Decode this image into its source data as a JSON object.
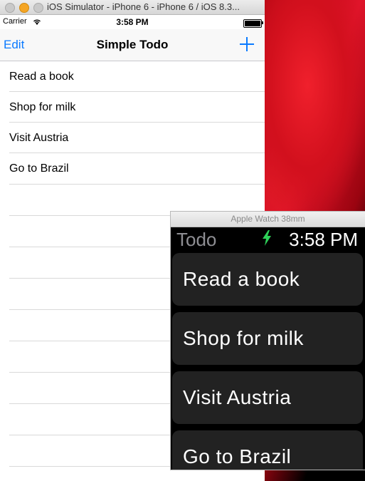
{
  "window": {
    "title": "iOS Simulator - iPhone 6 - iPhone 6 / iOS 8.3..."
  },
  "statusbar": {
    "carrier": "Carrier",
    "time": "3:58 PM"
  },
  "navbar": {
    "edit_label": "Edit",
    "title": "Simple Todo",
    "add_icon": "plus-icon"
  },
  "todos": [
    {
      "label": "Read a book"
    },
    {
      "label": "Shop for milk"
    },
    {
      "label": "Visit Austria"
    },
    {
      "label": "Go to Brazil"
    }
  ],
  "watch": {
    "device_title": "Apple Watch 38mm",
    "app_title": "Todo",
    "time": "3:58 PM",
    "charging_icon": "lightning-bolt-icon",
    "charging_color": "#2ed158",
    "rows": [
      {
        "label": "Read a book"
      },
      {
        "label": "Shop for milk"
      },
      {
        "label": "Visit Austria"
      },
      {
        "label": "Go to Brazil"
      }
    ]
  },
  "colors": {
    "ios_tint": "#0a7aff",
    "watch_cell": "#222222"
  }
}
